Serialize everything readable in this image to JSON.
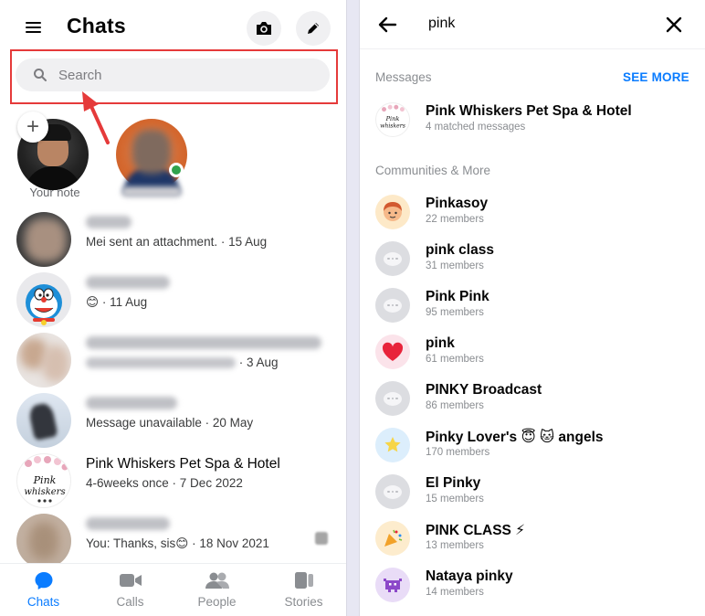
{
  "left": {
    "title": "Chats",
    "search_placeholder": "Search",
    "note_label": "Your note",
    "chats": [
      {
        "subtitle": "Mei sent an attachment. · 15 Aug"
      },
      {
        "subtitle_time": "· 11 Aug",
        "emoji": "😊"
      },
      {
        "subtitle_time": "· 3 Aug"
      },
      {
        "subtitle": "Message unavailable · 20 May"
      },
      {
        "name": "Pink Whiskers Pet Spa & Hotel",
        "subtitle": "4-6weeks once · 7 Dec 2022"
      },
      {
        "subtitle": "You: Thanks, sis😊 · 18 Nov 2021"
      }
    ],
    "tabs": [
      {
        "label": "Chats"
      },
      {
        "label": "Calls"
      },
      {
        "label": "People"
      },
      {
        "label": "Stories"
      }
    ],
    "colors": {
      "accent": "#0a7cff",
      "highlight": "#e53a3a",
      "online": "#31a24c"
    }
  },
  "right": {
    "query": "pink",
    "messages_title": "Messages",
    "see_more": "SEE MORE",
    "message_result": {
      "title": "Pink Whiskers Pet Spa & Hotel",
      "sub": "4 matched messages"
    },
    "communities_title": "Communities & More",
    "communities": [
      {
        "title": "Pinkasoy",
        "sub": "22 members"
      },
      {
        "title": "pink class",
        "sub": "31 members"
      },
      {
        "title": "Pink Pink",
        "sub": "95 members"
      },
      {
        "title": "pink",
        "sub": "61 members"
      },
      {
        "title": "PINKY Broadcast",
        "sub": "86 members"
      },
      {
        "title": "Pinky Lover's 😇 🐱 angels",
        "sub": "170 members"
      },
      {
        "title": "El Pinky",
        "sub": "15 members"
      },
      {
        "title": "PINK CLASS ⚡",
        "sub": "13 members"
      },
      {
        "title": "Nataya pinky",
        "sub": "14 members"
      }
    ]
  },
  "icons": {
    "menu": "menu-icon",
    "camera": "camera-icon",
    "pen": "pen-icon",
    "search": "search-icon",
    "back": "back-arrow-icon",
    "close": "close-icon",
    "chat": "chat-bubble-icon",
    "calls": "video-camera-icon",
    "people": "people-icon",
    "stories": "stories-icon"
  },
  "pink_logo_text": "Pink whiskers"
}
